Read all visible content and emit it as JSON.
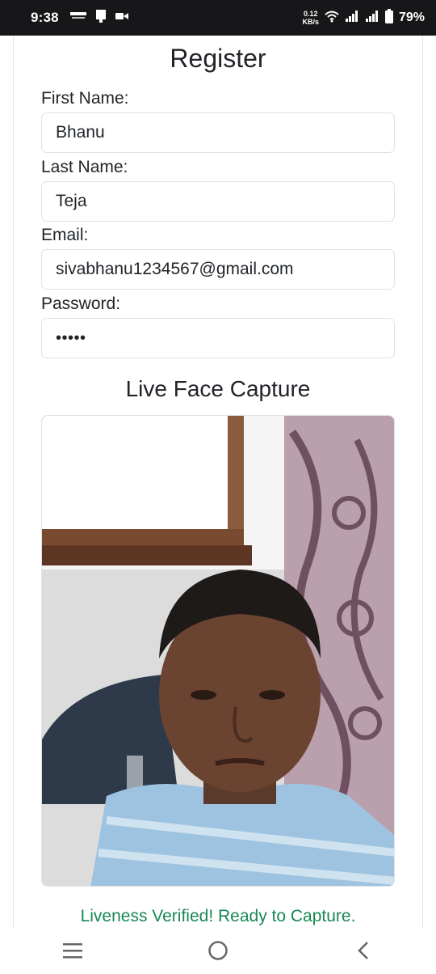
{
  "status_bar": {
    "time": "9:38",
    "net_speed_value": "0.12",
    "net_speed_unit": "KB/s",
    "battery": "79%",
    "icons": [
      "paytm-notification-icon",
      "sim-card-icon",
      "video-camera-icon",
      "wifi-icon",
      "signal-icon",
      "signal-icon",
      "battery-icon"
    ]
  },
  "form": {
    "title": "Register",
    "first_name": {
      "label": "First Name:",
      "value": "Bhanu"
    },
    "last_name": {
      "label": "Last Name:",
      "value": "Teja"
    },
    "email": {
      "label": "Email:",
      "value": "sivabhanu1234567@gmail.com"
    },
    "password": {
      "label": "Password:",
      "value": "•••••"
    }
  },
  "capture": {
    "title": "Live Face Capture",
    "status_message": "Liveness Verified! Ready to Capture.",
    "status_color": "#198754"
  },
  "nav_bar": {
    "icons": [
      "recent-apps-icon",
      "home-icon",
      "back-icon"
    ]
  }
}
